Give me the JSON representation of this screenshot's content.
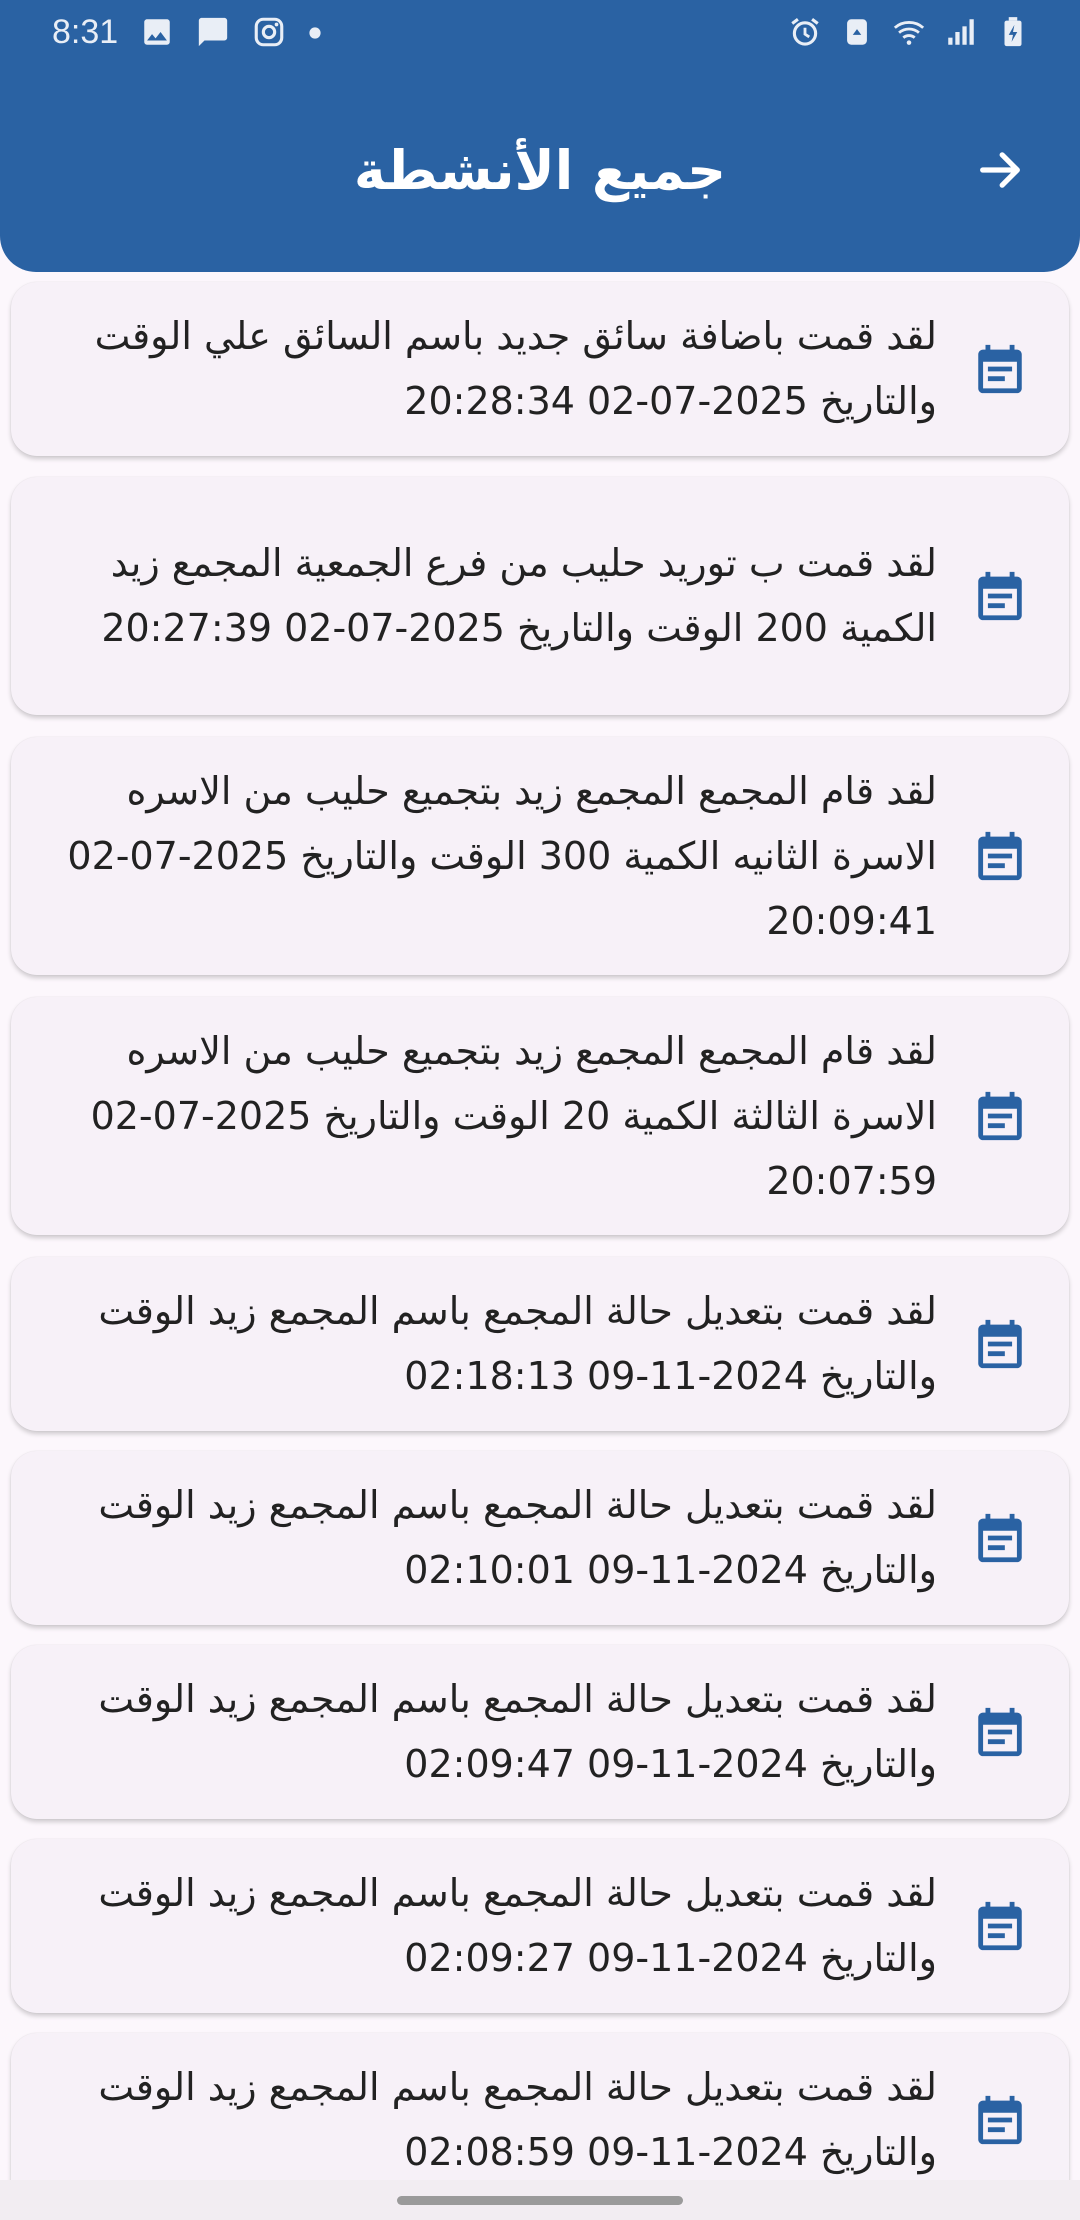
{
  "status_bar": {
    "time": "8:31",
    "left_icons": [
      "gallery-icon",
      "message-icon",
      "instagram-icon",
      "dot-icon"
    ],
    "right_icons": [
      "alarm-icon",
      "recycle-icon",
      "wifi-icon",
      "signal-icon",
      "battery-charging-icon"
    ]
  },
  "header": {
    "title": "جميع الأنشطة",
    "back_icon": "arrow-right-icon"
  },
  "colors": {
    "header_bg": "#2a62a3",
    "icon": "#2a62a3",
    "card_bg": "#f7f1f8",
    "page_bg": "#fcf7fc"
  },
  "activities": [
    {
      "text": "لقد قمت باضافة سائق جديد باسم السائق علي الوقت والتاريخ 2025-07-02 20:28:34",
      "icon": "calendar-icon"
    },
    {
      "text": "لقد قمت ب توريد حليب من فرع الجمعية المجمع زيد الكمية 200 الوقت والتاريخ 2025-07-02 20:27:39",
      "icon": "calendar-icon"
    },
    {
      "text": "لقد قام المجمع المجمع زيد بتجميع حليب من الاسره الاسرة الثانيه الكمية 300 الوقت والتاريخ 2025-07-02 20:09:41",
      "icon": "calendar-icon"
    },
    {
      "text": "لقد قام المجمع المجمع زيد بتجميع حليب من الاسره الاسرة الثالثة الكمية 20 الوقت والتاريخ 2025-07-02 20:07:59",
      "icon": "calendar-icon"
    },
    {
      "text": "لقد قمت بتعديل حالة المجمع باسم المجمع زيد الوقت والتاريخ 2024-11-09 02:18:13",
      "icon": "calendar-icon"
    },
    {
      "text": "لقد قمت بتعديل حالة المجمع باسم المجمع زيد الوقت والتاريخ 2024-11-09 02:10:01",
      "icon": "calendar-icon"
    },
    {
      "text": "لقد قمت بتعديل حالة المجمع باسم المجمع زيد الوقت والتاريخ 2024-11-09 02:09:47",
      "icon": "calendar-icon"
    },
    {
      "text": "لقد قمت بتعديل حالة المجمع باسم المجمع زيد الوقت والتاريخ 2024-11-09 02:09:27",
      "icon": "calendar-icon"
    },
    {
      "text": "لقد قمت بتعديل حالة المجمع باسم المجمع زيد الوقت والتاريخ 2024-11-09 02:08:59",
      "icon": "calendar-icon"
    }
  ]
}
